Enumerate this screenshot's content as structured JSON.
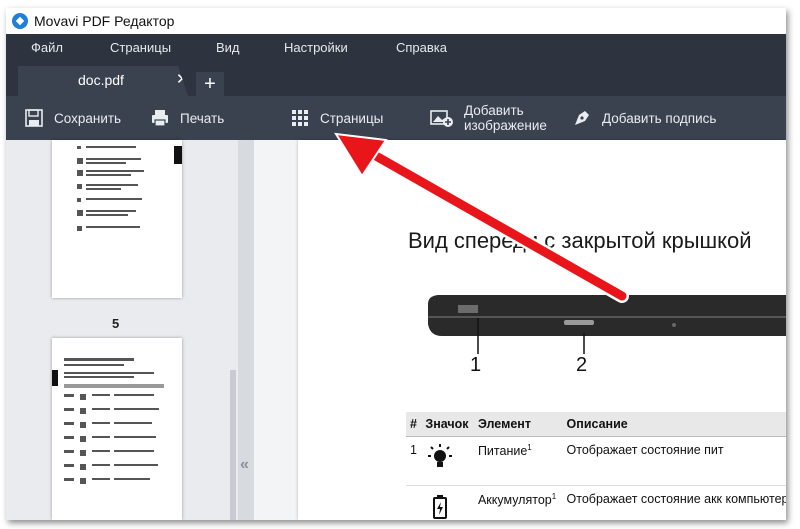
{
  "window": {
    "title": "Movavi PDF Редактор"
  },
  "menu": {
    "items": [
      "Файл",
      "Страницы",
      "Вид",
      "Настройки",
      "Справка"
    ]
  },
  "tabs": {
    "active": "doc.pdf",
    "close": "✕",
    "add": "+"
  },
  "toolbar": {
    "save": "Сохранить",
    "print": "Печать",
    "pages": "Страницы",
    "add_image_line1": "Добавить",
    "add_image_line2": "изображение",
    "add_signature": "Добавить подпись"
  },
  "sidebar": {
    "page_numbers": [
      "5"
    ],
    "collapse": "«"
  },
  "document": {
    "heading": "Вид спереди с закрытой крышкой",
    "callouts": [
      "1",
      "2"
    ],
    "table": {
      "headers": [
        "#",
        "Значок",
        "Элемент",
        "Описание"
      ],
      "rows": [
        {
          "num": "1",
          "icon": "power-light-icon",
          "element": "Питание",
          "sup": "1",
          "description": "Отображает состояние пит"
        },
        {
          "num": "",
          "icon": "battery-icon",
          "element": "Аккумулятор",
          "sup": "1",
          "description": "Отображает состояние акк компьютера"
        }
      ]
    }
  },
  "colors": {
    "toolbar_bg": "#3a4250",
    "menubar_bg": "#2d3440",
    "annotation_arrow": "#e8161b",
    "app_icon": "#1f7fd8"
  }
}
